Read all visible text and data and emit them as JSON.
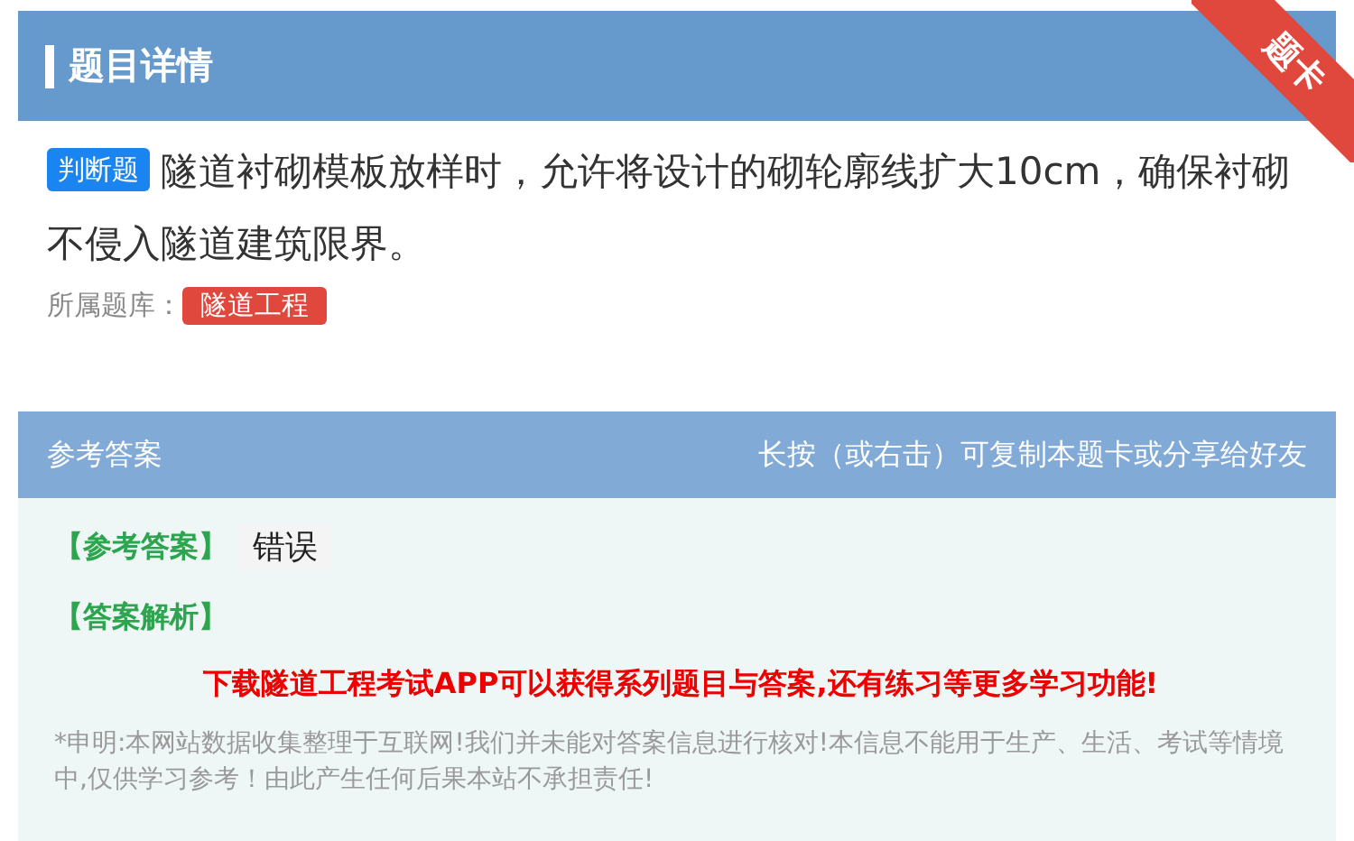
{
  "header": {
    "title": "题目详情",
    "ribbon": "题卡"
  },
  "question": {
    "type_badge": "判断题",
    "text": "隧道衬砌模板放样时，允许将设计的砌轮廓线扩大10cm，确保衬砌不侵入隧道建筑限界。",
    "bank_label": "所属题库：",
    "bank_tag": "隧道工程"
  },
  "answer": {
    "title": "参考答案",
    "hint": "长按（或右击）可复制本题卡或分享给好友",
    "answer_label": "【参考答案】",
    "answer_value": "错误",
    "analysis_label": "【答案解析】",
    "promo": "下载隧道工程考试APP可以获得系列题目与答案,还有练习等更多学习功能!",
    "disclaimer": "*申明:本网站数据收集整理于互联网!我们并未能对答案信息进行核对!本信息不能用于生产、生活、考试等情境中,仅供学习参考！由此产生任何后果本站不承担责任!"
  }
}
